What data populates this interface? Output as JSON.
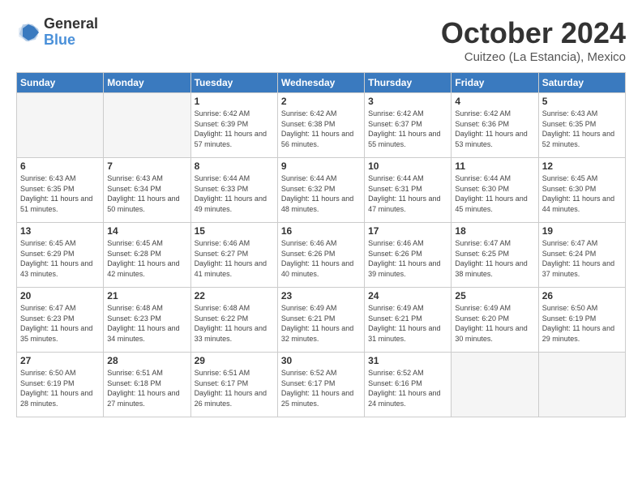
{
  "logo": {
    "general": "General",
    "blue": "Blue"
  },
  "title": "October 2024",
  "location": "Cuitzeo (La Estancia), Mexico",
  "days_of_week": [
    "Sunday",
    "Monday",
    "Tuesday",
    "Wednesday",
    "Thursday",
    "Friday",
    "Saturday"
  ],
  "weeks": [
    [
      {
        "day": "",
        "empty": true
      },
      {
        "day": "",
        "empty": true
      },
      {
        "day": "1",
        "sunrise": "6:42 AM",
        "sunset": "6:39 PM",
        "daylight": "11 hours and 57 minutes."
      },
      {
        "day": "2",
        "sunrise": "6:42 AM",
        "sunset": "6:38 PM",
        "daylight": "11 hours and 56 minutes."
      },
      {
        "day": "3",
        "sunrise": "6:42 AM",
        "sunset": "6:37 PM",
        "daylight": "11 hours and 55 minutes."
      },
      {
        "day": "4",
        "sunrise": "6:42 AM",
        "sunset": "6:36 PM",
        "daylight": "11 hours and 53 minutes."
      },
      {
        "day": "5",
        "sunrise": "6:43 AM",
        "sunset": "6:35 PM",
        "daylight": "11 hours and 52 minutes."
      }
    ],
    [
      {
        "day": "6",
        "sunrise": "6:43 AM",
        "sunset": "6:35 PM",
        "daylight": "11 hours and 51 minutes."
      },
      {
        "day": "7",
        "sunrise": "6:43 AM",
        "sunset": "6:34 PM",
        "daylight": "11 hours and 50 minutes."
      },
      {
        "day": "8",
        "sunrise": "6:44 AM",
        "sunset": "6:33 PM",
        "daylight": "11 hours and 49 minutes."
      },
      {
        "day": "9",
        "sunrise": "6:44 AM",
        "sunset": "6:32 PM",
        "daylight": "11 hours and 48 minutes."
      },
      {
        "day": "10",
        "sunrise": "6:44 AM",
        "sunset": "6:31 PM",
        "daylight": "11 hours and 47 minutes."
      },
      {
        "day": "11",
        "sunrise": "6:44 AM",
        "sunset": "6:30 PM",
        "daylight": "11 hours and 45 minutes."
      },
      {
        "day": "12",
        "sunrise": "6:45 AM",
        "sunset": "6:30 PM",
        "daylight": "11 hours and 44 minutes."
      }
    ],
    [
      {
        "day": "13",
        "sunrise": "6:45 AM",
        "sunset": "6:29 PM",
        "daylight": "11 hours and 43 minutes."
      },
      {
        "day": "14",
        "sunrise": "6:45 AM",
        "sunset": "6:28 PM",
        "daylight": "11 hours and 42 minutes."
      },
      {
        "day": "15",
        "sunrise": "6:46 AM",
        "sunset": "6:27 PM",
        "daylight": "11 hours and 41 minutes."
      },
      {
        "day": "16",
        "sunrise": "6:46 AM",
        "sunset": "6:26 PM",
        "daylight": "11 hours and 40 minutes."
      },
      {
        "day": "17",
        "sunrise": "6:46 AM",
        "sunset": "6:26 PM",
        "daylight": "11 hours and 39 minutes."
      },
      {
        "day": "18",
        "sunrise": "6:47 AM",
        "sunset": "6:25 PM",
        "daylight": "11 hours and 38 minutes."
      },
      {
        "day": "19",
        "sunrise": "6:47 AM",
        "sunset": "6:24 PM",
        "daylight": "11 hours and 37 minutes."
      }
    ],
    [
      {
        "day": "20",
        "sunrise": "6:47 AM",
        "sunset": "6:23 PM",
        "daylight": "11 hours and 35 minutes."
      },
      {
        "day": "21",
        "sunrise": "6:48 AM",
        "sunset": "6:23 PM",
        "daylight": "11 hours and 34 minutes."
      },
      {
        "day": "22",
        "sunrise": "6:48 AM",
        "sunset": "6:22 PM",
        "daylight": "11 hours and 33 minutes."
      },
      {
        "day": "23",
        "sunrise": "6:49 AM",
        "sunset": "6:21 PM",
        "daylight": "11 hours and 32 minutes."
      },
      {
        "day": "24",
        "sunrise": "6:49 AM",
        "sunset": "6:21 PM",
        "daylight": "11 hours and 31 minutes."
      },
      {
        "day": "25",
        "sunrise": "6:49 AM",
        "sunset": "6:20 PM",
        "daylight": "11 hours and 30 minutes."
      },
      {
        "day": "26",
        "sunrise": "6:50 AM",
        "sunset": "6:19 PM",
        "daylight": "11 hours and 29 minutes."
      }
    ],
    [
      {
        "day": "27",
        "sunrise": "6:50 AM",
        "sunset": "6:19 PM",
        "daylight": "11 hours and 28 minutes."
      },
      {
        "day": "28",
        "sunrise": "6:51 AM",
        "sunset": "6:18 PM",
        "daylight": "11 hours and 27 minutes."
      },
      {
        "day": "29",
        "sunrise": "6:51 AM",
        "sunset": "6:17 PM",
        "daylight": "11 hours and 26 minutes."
      },
      {
        "day": "30",
        "sunrise": "6:52 AM",
        "sunset": "6:17 PM",
        "daylight": "11 hours and 25 minutes."
      },
      {
        "day": "31",
        "sunrise": "6:52 AM",
        "sunset": "6:16 PM",
        "daylight": "11 hours and 24 minutes."
      },
      {
        "day": "",
        "empty": true
      },
      {
        "day": "",
        "empty": true
      }
    ]
  ]
}
